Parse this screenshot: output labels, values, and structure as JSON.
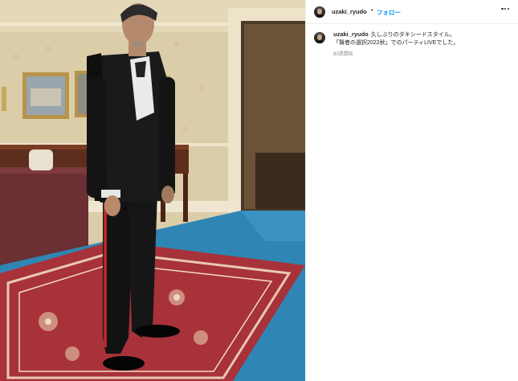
{
  "post": {
    "username": "uzaki_ryudo",
    "separator": "•",
    "follow_label": "フォロー",
    "more_icon": "more-horizontal-icon"
  },
  "caption": {
    "username": "uzaki_ryudo",
    "line1": "久しぶりのタキシードスタイル。",
    "line2": "「賢者の選択2022秋」でのパーティLIVEでした。",
    "time": "80週間前"
  },
  "colors": {
    "follow": "#0095f6",
    "text": "#262626",
    "muted": "#8e8e8e",
    "carpet_red": "#a8323a",
    "carpet_blue": "#2f86b5"
  }
}
